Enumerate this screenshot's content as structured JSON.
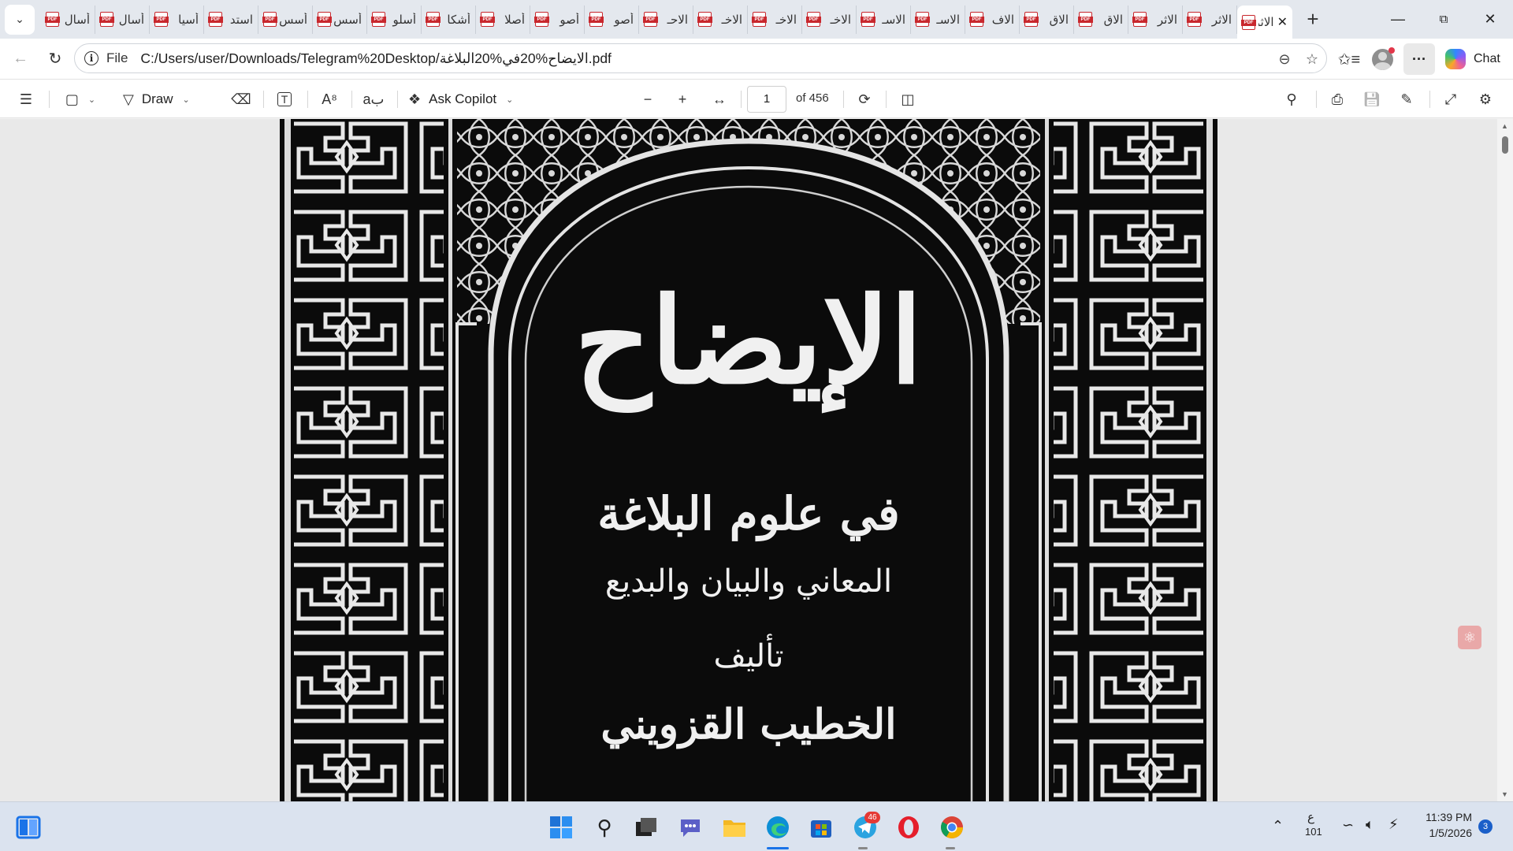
{
  "browser": {
    "tabs": [
      {
        "label": "أسال",
        "active": false
      },
      {
        "label": "أسال",
        "active": false
      },
      {
        "label": "أسيا",
        "active": false
      },
      {
        "label": "استد",
        "active": false
      },
      {
        "label": "أسس",
        "active": false
      },
      {
        "label": "أسس",
        "active": false
      },
      {
        "label": "أسلو",
        "active": false
      },
      {
        "label": "أشكا",
        "active": false
      },
      {
        "label": "أصلا",
        "active": false
      },
      {
        "label": "أصو",
        "active": false
      },
      {
        "label": "أصو",
        "active": false
      },
      {
        "label": "الاحـ",
        "active": false
      },
      {
        "label": "الاخـ",
        "active": false
      },
      {
        "label": "الاخـ",
        "active": false
      },
      {
        "label": "الاخـ",
        "active": false
      },
      {
        "label": "الاسـ",
        "active": false
      },
      {
        "label": "الاسـ",
        "active": false
      },
      {
        "label": "الاف",
        "active": false
      },
      {
        "label": "الاق",
        "active": false
      },
      {
        "label": "الاق",
        "active": false
      },
      {
        "label": "الاثر",
        "active": false
      },
      {
        "label": "الاثر",
        "active": false
      },
      {
        "label": "الاثر",
        "active": true
      }
    ],
    "new_tab_label": "+",
    "url_scheme_label": "File",
    "url": "C:/Users/user/Downloads/Telegram%20Desktop/الايضاح%20في%20البلاغة.pdf",
    "chat_label": "Chat"
  },
  "pdf_toolbar": {
    "draw_label": "Draw",
    "ask_copilot_label": "Ask Copilot",
    "current_page": "1",
    "page_count_label": "of 456"
  },
  "document": {
    "title": "الإيضاح",
    "subtitle": "في علوم البلاغة",
    "topics": "المعاني والبيان والبديع",
    "authorship_label": "تأليف",
    "author": "الخطيب القزويني"
  },
  "taskbar": {
    "telegram_badge": "46",
    "lang_indicator": "ع",
    "lang_sub": "101",
    "time": "11:39 PM",
    "date": "1/5/2026",
    "notification_count": "3"
  },
  "colors": {
    "tab_strip": "#e4e8ee",
    "page_bg": "#0b0b0b",
    "page_ink": "#f0f0f0",
    "taskbar": "#dbe3ef",
    "pdf_red": "#c8272d"
  }
}
